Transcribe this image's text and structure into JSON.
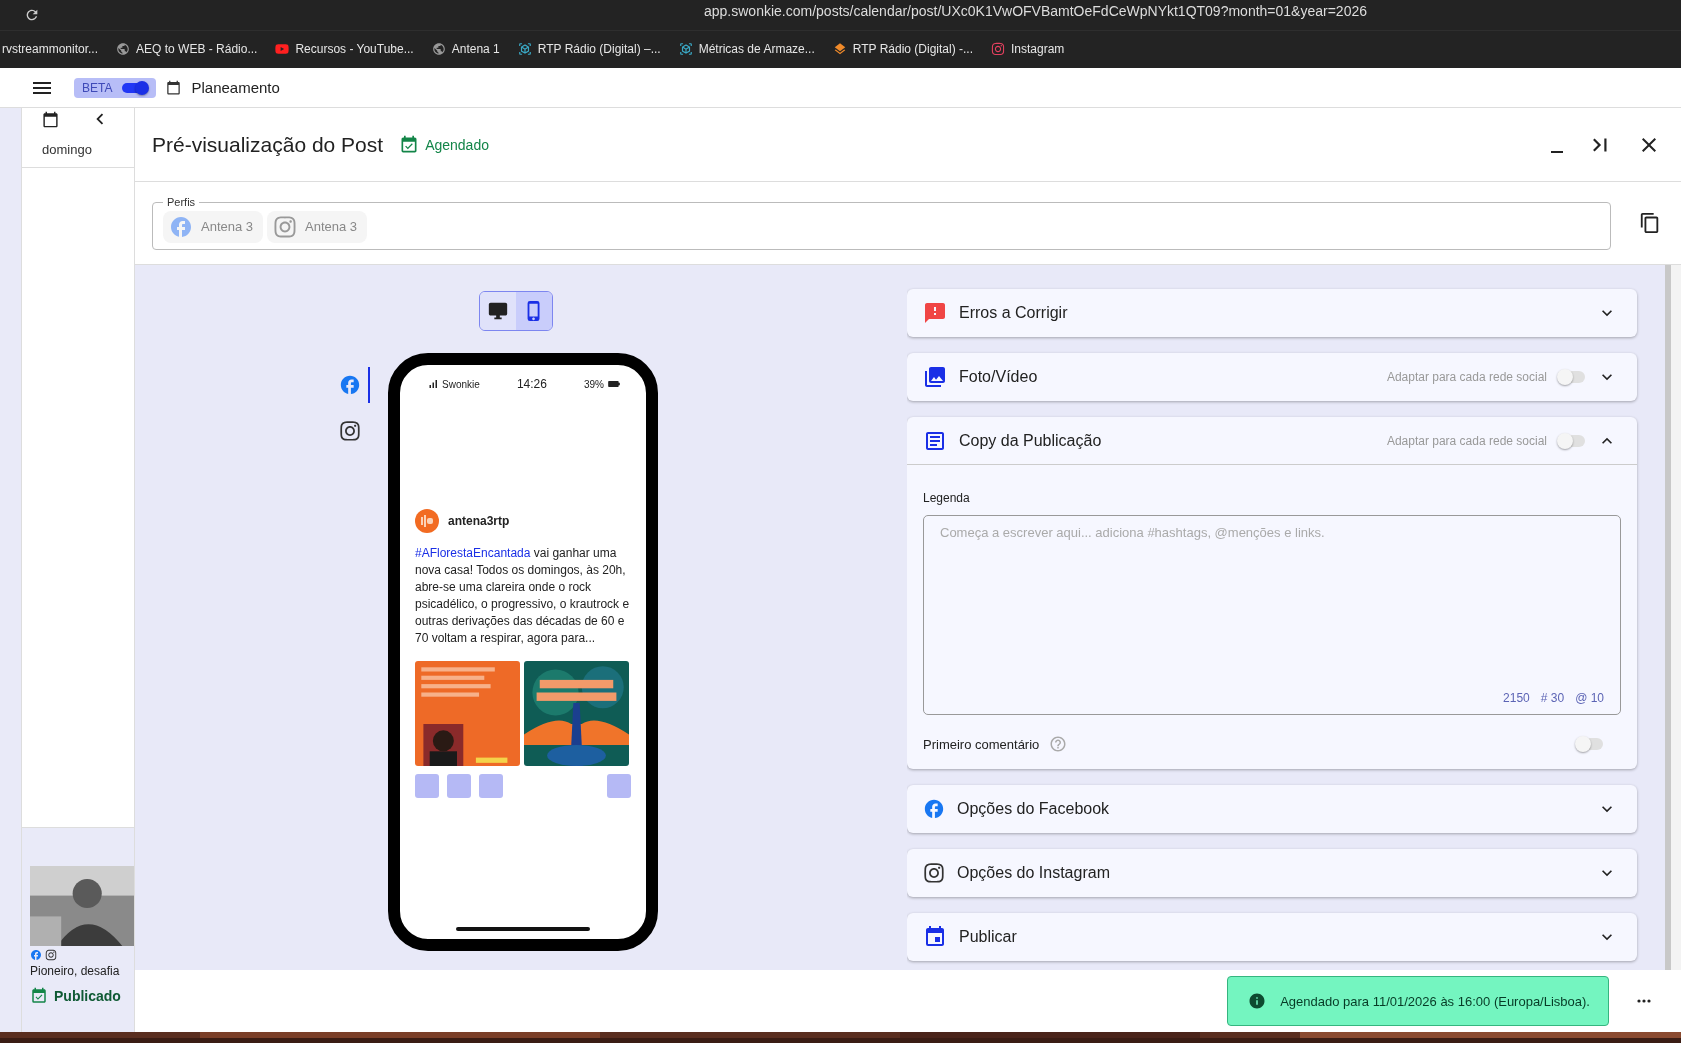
{
  "browser": {
    "url": "app.swonkie.com/posts/calendar/post/UXc0K1VwOFVBamtOeFdCeWpNYkt1QT09?month=01&year=2026",
    "bookmarks": [
      {
        "label": "rvstreammonitor..."
      },
      {
        "label": "AEQ to WEB - Rádio..."
      },
      {
        "label": "Recursos - YouTube..."
      },
      {
        "label": "Antena 1"
      },
      {
        "label": "RTP Rádio (Digital) –..."
      },
      {
        "label": "Métricas de Armaze..."
      },
      {
        "label": "RTP Rádio (Digital) -..."
      },
      {
        "label": "Instagram"
      }
    ]
  },
  "app_header": {
    "beta_label": "BETA",
    "beta_on": true,
    "section": "Planeamento"
  },
  "calendar": {
    "day": "domingo",
    "post": {
      "caption": "Pioneiro, desafia",
      "status": "Publicado"
    }
  },
  "modal": {
    "title": "Pré-visualização do Post",
    "status": "Agendado",
    "profiles": {
      "legend": "Perfis",
      "items": [
        {
          "kind": "facebook",
          "name": "Antena 3"
        },
        {
          "kind": "instagram",
          "name": "Antena 3"
        }
      ]
    },
    "preview": {
      "devices": [
        {
          "kind": "desktop",
          "selected": false
        },
        {
          "kind": "mobile",
          "selected": true
        }
      ],
      "networks": [
        {
          "kind": "facebook",
          "selected": true
        },
        {
          "kind": "instagram",
          "selected": false
        }
      ],
      "phone": {
        "carrier": "Swonkie",
        "time": "14:26",
        "battery": "39%",
        "account": "antena3rtp",
        "hashtag": "#AFlorestaEncantada",
        "caption": " vai ganhar uma nova casa! Todos os domingos, às 20h, abre-se uma clareira onde o rock psicadélico, o progressivo, o krautrock e outras derivações das décadas de 60 e 70 voltam a respirar, agora para..."
      }
    },
    "sections": [
      {
        "kind": "errors",
        "title": "Erros a Corrigir",
        "expanded": false
      },
      {
        "kind": "media",
        "title": "Foto/Vídeo",
        "adapt_label": "Adaptar para cada rede social",
        "adapt_on": false,
        "expanded": false
      },
      {
        "kind": "copy",
        "title": "Copy da Publicação",
        "adapt_label": "Adaptar para cada rede social",
        "adapt_on": false,
        "expanded": true,
        "caption_label": "Legenda",
        "placeholder": "Começa a escrever aqui... adiciona #hashtags, @menções e links.",
        "counters": [
          "2150",
          "# 30",
          "@ 10"
        ],
        "first_comment_label": "Primeiro comentário",
        "first_comment_on": false
      },
      {
        "kind": "facebook",
        "title": "Opções do Facebook",
        "expanded": false
      },
      {
        "kind": "instagram",
        "title": "Opções do Instagram",
        "expanded": false
      },
      {
        "kind": "publish",
        "title": "Publicar",
        "expanded": false
      }
    ],
    "toast": "Agendado para 11/01/2026 às 16:00 (Europa/Lisboa)."
  }
}
